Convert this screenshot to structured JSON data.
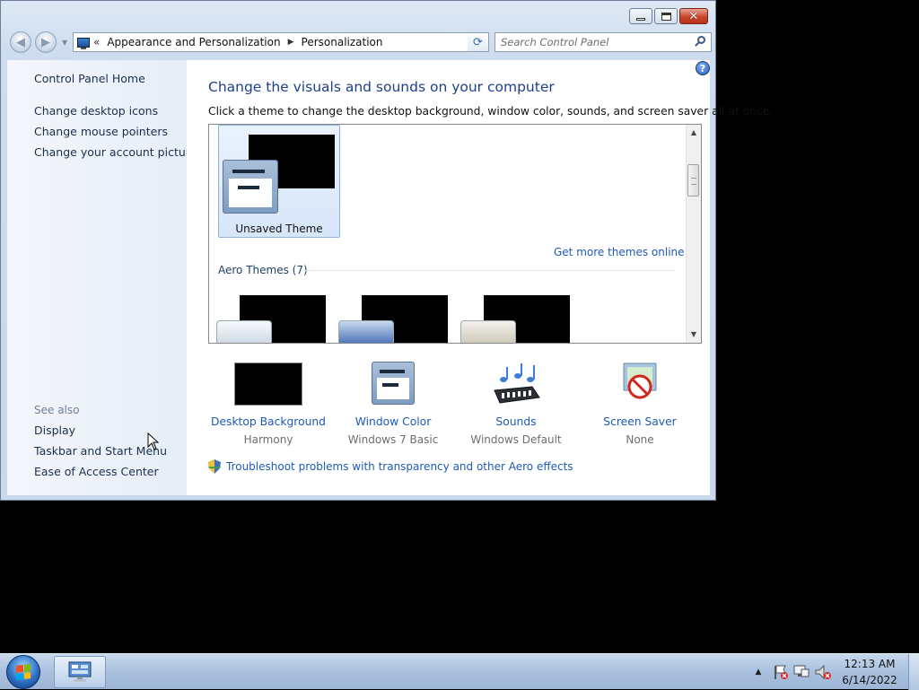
{
  "window": {
    "caption_buttons": {
      "minimize": "—",
      "maximize": "□",
      "close": "✕"
    },
    "address_bar": {
      "overflow_chevron": "«",
      "breadcrumbs": [
        "Appearance and Personalization",
        "Personalization"
      ],
      "separator": "▶",
      "dropdown_glyph": "▼"
    },
    "refresh_glyph": "⟳",
    "search_placeholder": "Search Control Panel"
  },
  "sidebar": {
    "links": [
      "Control Panel Home",
      "Change desktop icons",
      "Change mouse pointers",
      "Change your account picture"
    ],
    "see_also_label": "See also",
    "see_also_links": [
      "Display",
      "Taskbar and Start Menu",
      "Ease of Access Center"
    ]
  },
  "main": {
    "help_glyph": "?",
    "title": "Change the visuals and sounds on your computer",
    "description": "Click a theme to change the desktop background, window color, sounds, and screen saver all at once.",
    "themes": {
      "selected_theme": "Unsaved Theme",
      "more_themes_link": "Get more themes online",
      "group_label": "Aero Themes (7)",
      "scroll_up": "▲",
      "scroll_down": "▼"
    },
    "settings": [
      {
        "name": "Desktop Background",
        "value": "Harmony",
        "icon": "desktop-background-icon"
      },
      {
        "name": "Window Color",
        "value": "Windows 7 Basic",
        "icon": "window-color-icon"
      },
      {
        "name": "Sounds",
        "value": "Windows Default",
        "icon": "sounds-icon"
      },
      {
        "name": "Screen Saver",
        "value": "None",
        "icon": "screen-saver-icon"
      }
    ],
    "troubleshoot_link": "Troubleshoot problems with transparency and other Aero effects"
  },
  "taskbar": {
    "tray_arrow": "▲",
    "clock_time": "12:13 AM",
    "clock_date": "6/14/2022"
  },
  "colors": {
    "link_blue": "#1e5ab5",
    "title_blue": "#1e3f8a",
    "selection_bg": "#d6e6f9"
  }
}
